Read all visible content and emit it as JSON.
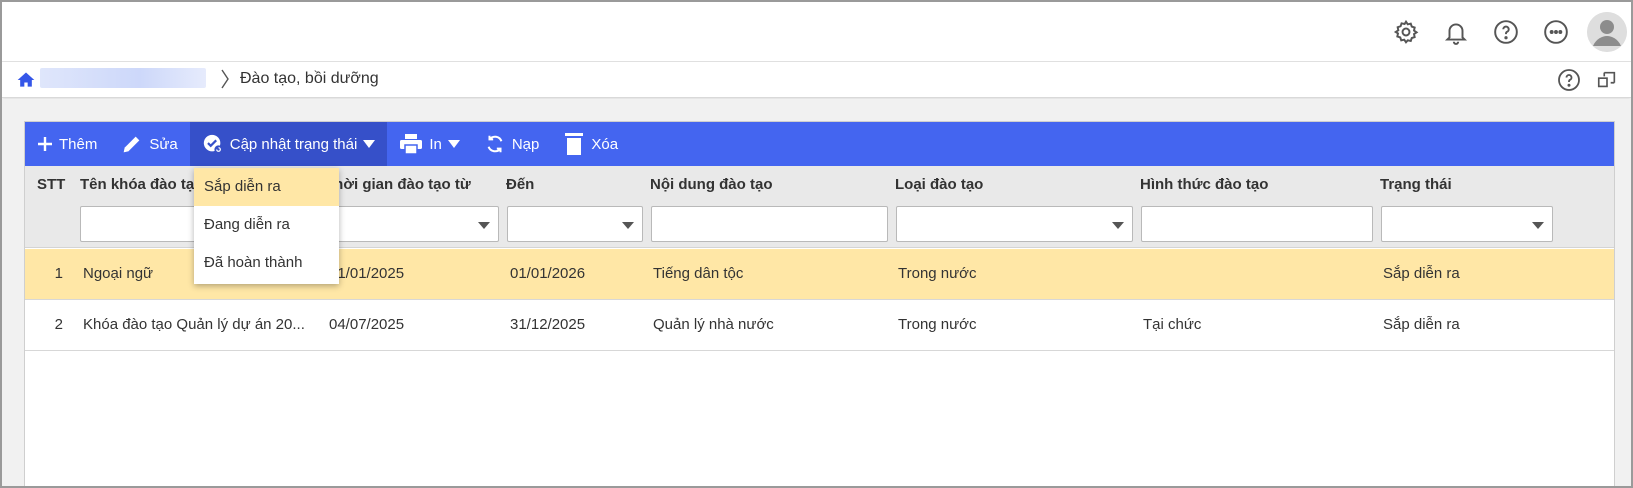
{
  "breadcrumb": {
    "current": "Đào tạo, bồi dưỡng"
  },
  "toolbar": {
    "add_label": "Thêm",
    "edit_label": "Sửa",
    "update_status_label": "Cập nhật trạng thái",
    "print_label": "In",
    "reload_label": "Nạp",
    "delete_label": "Xóa"
  },
  "status_menu": {
    "items": [
      "Sắp diễn ra",
      "Đang diễn ra",
      "Đã hoàn thành"
    ],
    "highlighted": "Sắp diễn ra"
  },
  "table": {
    "columns": {
      "stt": "STT",
      "course_name": "Tên khóa đào tạo",
      "start_time": "Thời gian đào tạo từ",
      "end_time": "Đến",
      "content": "Nội dung đào tạo",
      "type": "Loại đào tạo",
      "form": "Hình thức đào tạo",
      "status": "Trạng thái"
    },
    "rows": [
      {
        "stt": "1",
        "course_name": "Ngoại ngữ",
        "start_time": "01/01/2025",
        "end_time": "01/01/2026",
        "content": "Tiếng dân tộc",
        "type": "Trong nước",
        "form": "",
        "status": "Sắp diễn ra"
      },
      {
        "stt": "2",
        "course_name": "Khóa đào tạo Quản lý dự án 20...",
        "start_time": "04/07/2025",
        "end_time": "31/12/2025",
        "content": "Quản lý nhà nước",
        "type": "Trong nước",
        "form": "Tại chức",
        "status": "Sắp diễn ra"
      }
    ]
  },
  "colors": {
    "toolbar": "#4465f0",
    "selected_row": "#ffe7a6"
  }
}
